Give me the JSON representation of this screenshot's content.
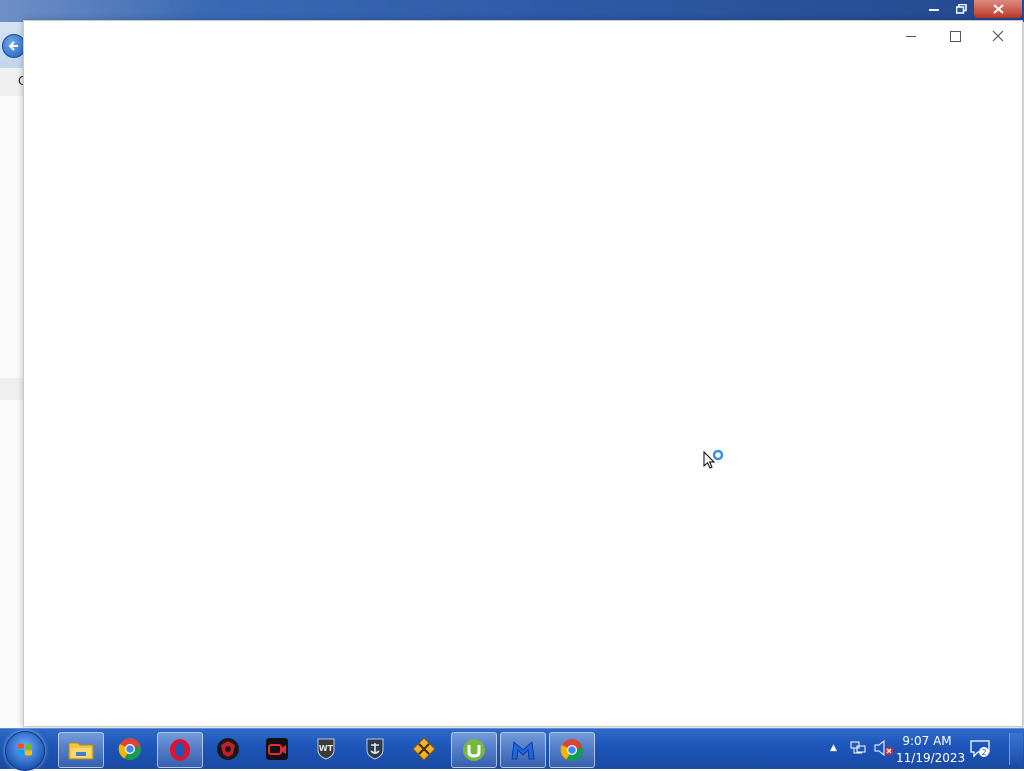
{
  "background_window": {
    "menu_partial": "C",
    "back_arrow": "arrow-left-icon"
  },
  "taskbar": {
    "apps": [
      {
        "name": "file-explorer-icon",
        "active": true
      },
      {
        "name": "chrome-icon",
        "active": false
      },
      {
        "name": "opera-icon",
        "active": true
      },
      {
        "name": "app-red-shield-icon",
        "active": false
      },
      {
        "name": "video-recorder-icon",
        "active": false
      },
      {
        "name": "world-of-tanks-icon",
        "active": false
      },
      {
        "name": "world-of-warships-icon",
        "active": false
      },
      {
        "name": "yellow-diamond-game-icon",
        "active": false
      },
      {
        "name": "utorrent-icon",
        "active": true
      },
      {
        "name": "malwarebytes-icon",
        "active": true
      },
      {
        "name": "chrome-icon",
        "active": true
      }
    ]
  },
  "tray": {
    "time": "9:07 AM",
    "date": "11/19/2023",
    "notifications": "2"
  },
  "colors": {
    "taskbar": "#1d55b8",
    "titlebar": "#2d5aa6",
    "close_red": "#c0392b"
  }
}
